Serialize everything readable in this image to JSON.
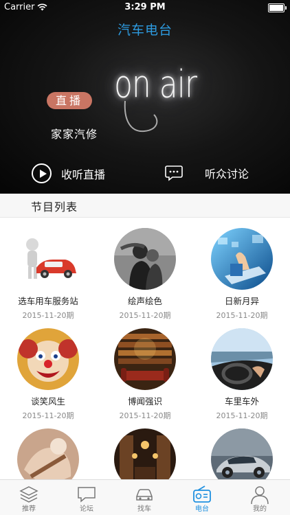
{
  "status_bar": {
    "carrier": "Carrier",
    "time": "3:29 PM"
  },
  "header": {
    "title": "汽车电台"
  },
  "hero": {
    "neon_text": "on air",
    "badge": "直播",
    "program_name": "家家汽修",
    "listen_label": "收听直播",
    "discuss_label": "听众讨论"
  },
  "section": {
    "title": "节目列表"
  },
  "programs": [
    {
      "title": "选车用车服务站",
      "date": "2015-11-20期"
    },
    {
      "title": "绘声绘色",
      "date": "2015-11-20期"
    },
    {
      "title": "日新月异",
      "date": "2015-11-20期"
    },
    {
      "title": "谈笑风生",
      "date": "2015-11-20期"
    },
    {
      "title": "博闻强识",
      "date": "2015-11-20期"
    },
    {
      "title": "车里车外",
      "date": "2015-11-20期"
    },
    {
      "title": "",
      "date": ""
    },
    {
      "title": "",
      "date": ""
    },
    {
      "title": "",
      "date": ""
    }
  ],
  "tabs": [
    {
      "label": "推荐",
      "icon": "layers-icon"
    },
    {
      "label": "论坛",
      "icon": "chat-bubble-icon"
    },
    {
      "label": "找车",
      "icon": "car-icon"
    },
    {
      "label": "电台",
      "icon": "radio-icon"
    },
    {
      "label": "我的",
      "icon": "person-icon"
    }
  ],
  "colors": {
    "accent": "#1e90e0",
    "title_blue": "#2d9be0",
    "badge": "#c97563"
  }
}
